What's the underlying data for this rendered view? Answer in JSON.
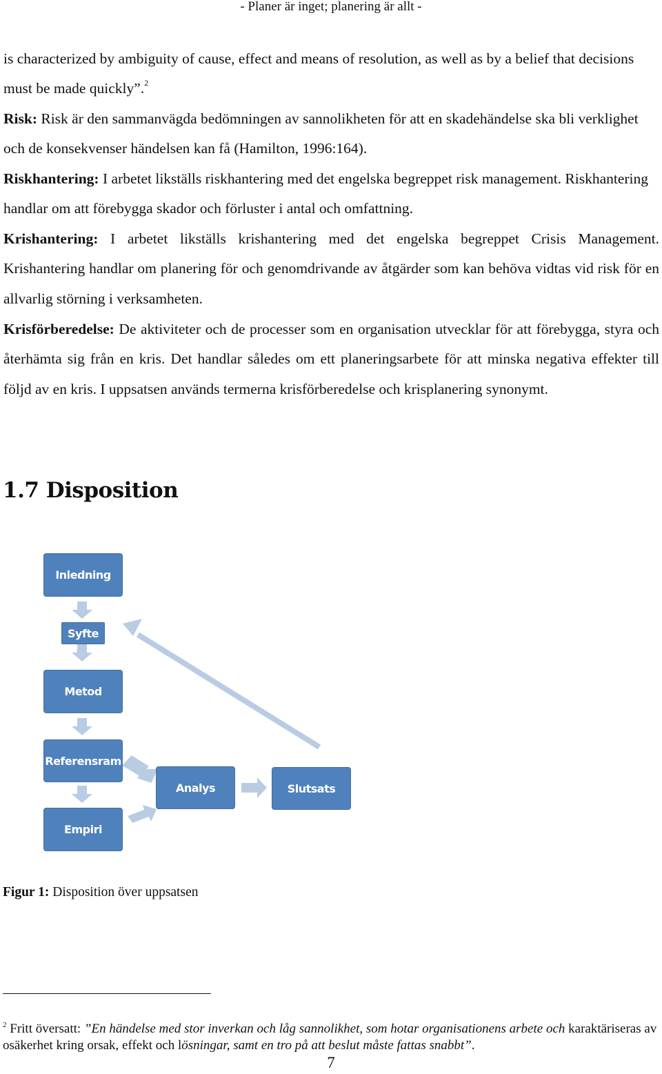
{
  "header": {
    "running_title": "- Planer är inget; planering är allt -"
  },
  "body": {
    "continuation": {
      "text": "is characterized by ambiguity of cause, effect and means of resolution, as well as by a belief that decisions must be made quickly”.",
      "footnote_ref": "2"
    },
    "definitions": [
      {
        "term": "Risk:",
        "text": " Risk är den sammanvägda bedömningen av sannolikheten för att en skadehändelse ska bli verklighet och de konsekvenser händelsen kan få (Hamilton, 1996:164)."
      },
      {
        "term": "Riskhantering:",
        "text": " I arbetet likställs riskhantering med det engelska begreppet risk management. Riskhantering handlar om att förebygga skador och förluster i antal och omfattning."
      },
      {
        "term": "Krishantering:",
        "text": " I arbetet likställs krishantering med det engelska begreppet Crisis Management. Krishantering handlar om planering för och genomdrivande av åtgärder som kan behöva vidtas vid risk för en allvarlig störning i verksamheten."
      },
      {
        "term": "Krisförberedelse:",
        "text": " De aktiviteter och de processer som en organisation utvecklar för att förebygga, styra och återhämta sig från en kris. Det handlar således om ett planeringsarbete för att minska negativa effekter till följd av en kris. I uppsatsen används termerna krisförberedelse och krisplanering synonymt."
      }
    ]
  },
  "section": {
    "number": "1.7",
    "title": "Disposition"
  },
  "diagram": {
    "box_color": "#4f81bd",
    "arrow_color": "#b8cce4",
    "nodes": [
      {
        "id": "inledning",
        "label": "Inledning"
      },
      {
        "id": "syfte",
        "label": "Syfte"
      },
      {
        "id": "metod",
        "label": "Metod"
      },
      {
        "id": "referensram",
        "label": "Referensram"
      },
      {
        "id": "empiri",
        "label": "Empiri"
      },
      {
        "id": "analys",
        "label": "Analys"
      },
      {
        "id": "slutsats",
        "label": "Slutsats"
      }
    ],
    "edges": [
      {
        "from": "inledning",
        "to": "syfte"
      },
      {
        "from": "syfte",
        "to": "metod"
      },
      {
        "from": "metod",
        "to": "referensram"
      },
      {
        "from": "referensram",
        "to": "empiri"
      },
      {
        "from": "referensram",
        "to": "analys"
      },
      {
        "from": "empiri",
        "to": "analys"
      },
      {
        "from": "analys",
        "to": "slutsats"
      },
      {
        "from": "slutsats",
        "to": "syfte"
      }
    ]
  },
  "caption": {
    "label": "Figur 1:",
    "text": " Disposition över uppsatsen"
  },
  "footnote": {
    "number": "2",
    "prefix": " Fritt översatt: ",
    "quote_part1": "”En händelse med stor inverkan och låg sannolikhet, som hotar organisationens arbete och ",
    "plain_part": "karaktäriseras av osäkerhet kring orsak, effekt och l",
    "quote_part2": "ösningar, samt en tro på att beslut måste fattas snabbt”",
    "suffix": "."
  },
  "page_number": "7"
}
